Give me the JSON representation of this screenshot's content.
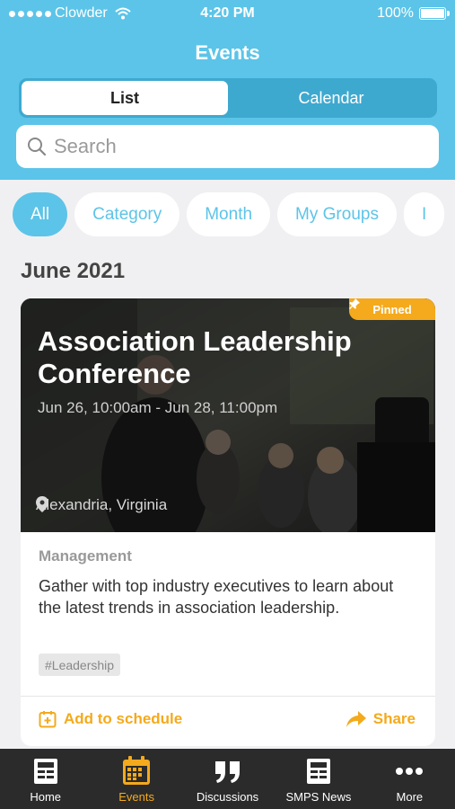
{
  "status_bar": {
    "carrier": "Clowder",
    "time": "4:20 PM",
    "battery": "100%"
  },
  "header": {
    "title": "Events"
  },
  "segments": {
    "list": "List",
    "calendar": "Calendar",
    "selected": "List"
  },
  "search": {
    "placeholder": "Search"
  },
  "filters": [
    "All",
    "Category",
    "Month",
    "My Groups",
    "I"
  ],
  "section": {
    "month": "June 2021"
  },
  "event": {
    "pinned_label": "Pinned",
    "title": "Association Leadership Conference",
    "dates": "Jun 26, 10:00am - Jun 28, 11:00pm",
    "location": "Alexandria, Virginia",
    "category": "Management",
    "description": "Gather with top industry executives to learn about the latest trends in association leadership.",
    "tag": "#Leadership",
    "add_label": "Add to schedule",
    "share_label": "Share"
  },
  "tabs": [
    {
      "label": "Home",
      "icon": "home-icon"
    },
    {
      "label": "Events",
      "icon": "calendar-icon"
    },
    {
      "label": "Discussions",
      "icon": "quote-icon"
    },
    {
      "label": "SMPS News",
      "icon": "news-icon"
    },
    {
      "label": "More",
      "icon": "more-icon"
    }
  ],
  "colors": {
    "accent": "#5cc4e8",
    "highlight": "#f4aa1c",
    "tabbar": "#2b2b2b"
  }
}
